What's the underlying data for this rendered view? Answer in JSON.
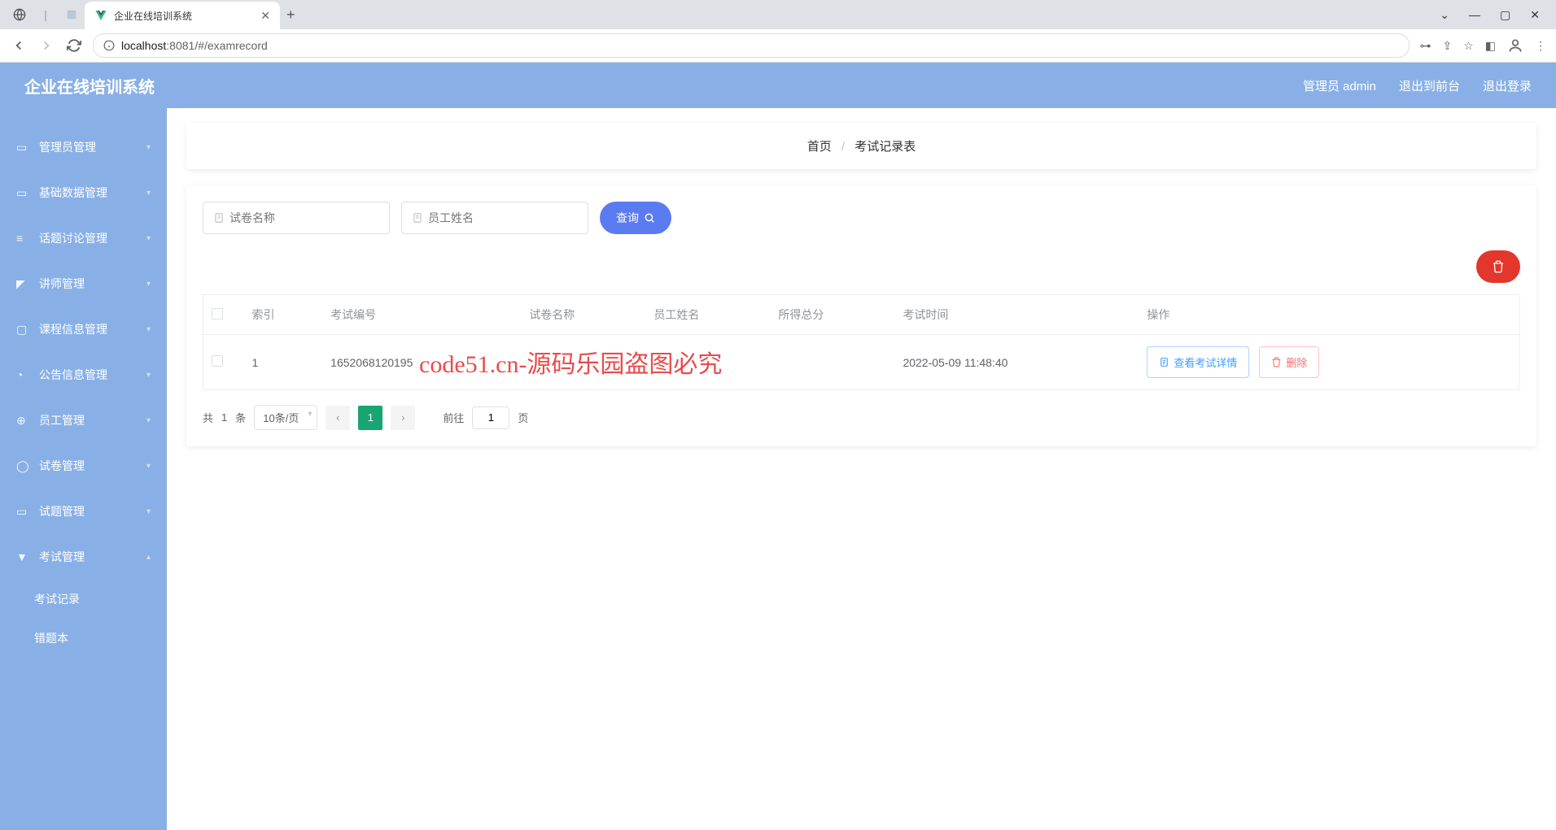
{
  "browser": {
    "tab_title": "企业在线培训系统",
    "url_host": "localhost",
    "url_port": ":8081",
    "url_path": "/#/examrecord"
  },
  "header": {
    "app_title": "企业在线培训系统",
    "user_label": "管理员 admin",
    "to_front": "退出到前台",
    "logout": "退出登录"
  },
  "sidebar": {
    "items": [
      {
        "label": "管理员管理"
      },
      {
        "label": "基础数据管理"
      },
      {
        "label": "话题讨论管理"
      },
      {
        "label": "讲师管理"
      },
      {
        "label": "课程信息管理"
      },
      {
        "label": "公告信息管理"
      },
      {
        "label": "员工管理"
      },
      {
        "label": "试卷管理"
      },
      {
        "label": "试题管理"
      },
      {
        "label": "考试管理"
      }
    ],
    "submenu": [
      {
        "label": "考试记录"
      },
      {
        "label": "错题本"
      }
    ]
  },
  "breadcrumb": {
    "home": "首页",
    "current": "考试记录表"
  },
  "search": {
    "paper_placeholder": "试卷名称",
    "employee_placeholder": "员工姓名",
    "query_btn": "查询"
  },
  "table": {
    "headers": {
      "index": "索引",
      "exam_no": "考试编号",
      "paper_name": "试卷名称",
      "employee": "员工姓名",
      "score": "所得总分",
      "time": "考试时间",
      "ops": "操作"
    },
    "rows": [
      {
        "index": "1",
        "exam_no": "1652068120195",
        "paper_name": "",
        "employee": "",
        "score": "",
        "time": "2022-05-09 11:48:40"
      }
    ],
    "ops": {
      "detail": "查看考试详情",
      "delete": "删除"
    }
  },
  "pagination": {
    "total_prefix": "共",
    "total_count": "1",
    "total_suffix": "条",
    "size_label": "10条/页",
    "current": "1",
    "goto_prefix": "前往",
    "goto_value": "1",
    "goto_suffix": "页"
  },
  "watermark": "code51.cn",
  "overlay": "code51.cn-源码乐园盗图必究"
}
